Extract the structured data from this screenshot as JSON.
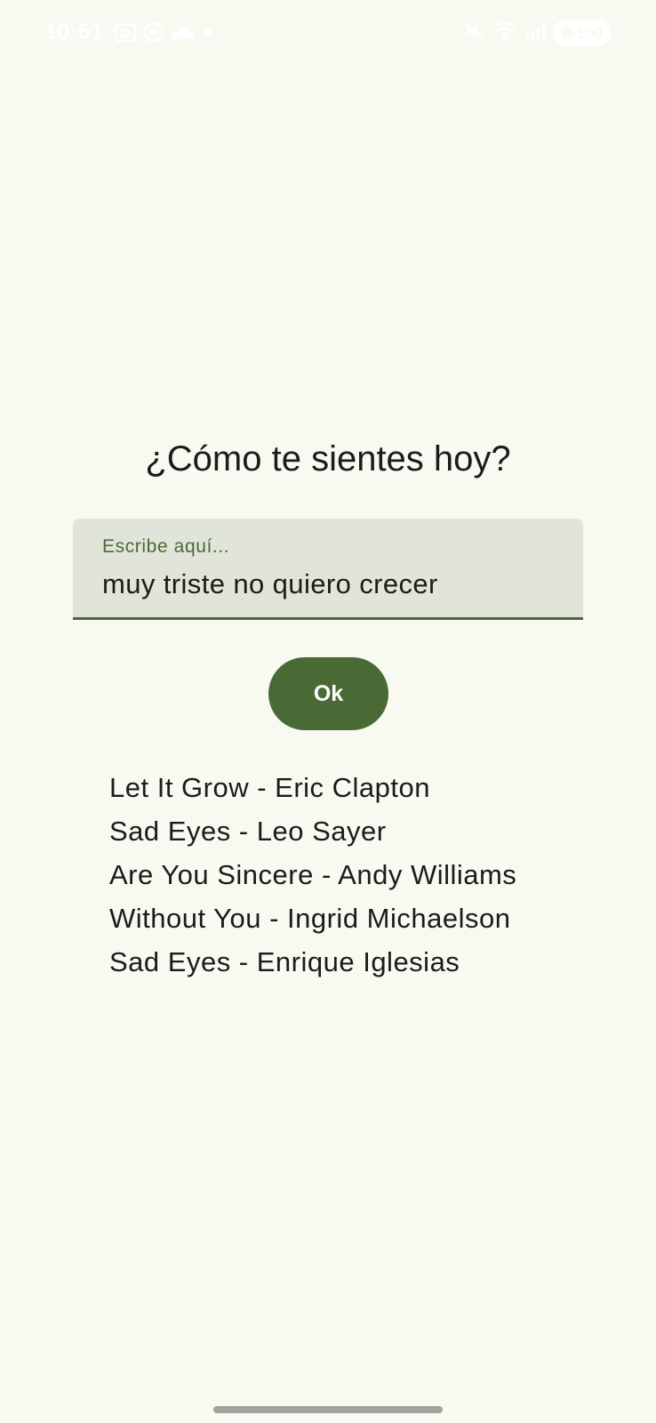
{
  "status_bar": {
    "time": "10:51",
    "left_icons": [
      "screenshot-icon",
      "whatsapp-icon",
      "cloud-icon",
      "dot-icon"
    ],
    "right_icons": [
      "mute-icon",
      "wifi-icon",
      "signal-icon"
    ],
    "battery": "100"
  },
  "main": {
    "title": "¿Cómo te sientes hoy?",
    "input": {
      "label": "Escribe aquí...",
      "value": "muy triste no quiero crecer"
    },
    "ok_button": "Ok",
    "songs": [
      "Let It Grow - Eric Clapton",
      "Sad Eyes - Leo Sayer",
      "Are You Sincere - Andy Williams",
      "Without You - Ingrid Michaelson",
      "Sad Eyes - Enrique Iglesias"
    ]
  },
  "colors": {
    "background": "#f8f9f0",
    "accent": "#4a6a35",
    "field_background": "#e1e4d9",
    "text": "#1b1c18"
  }
}
